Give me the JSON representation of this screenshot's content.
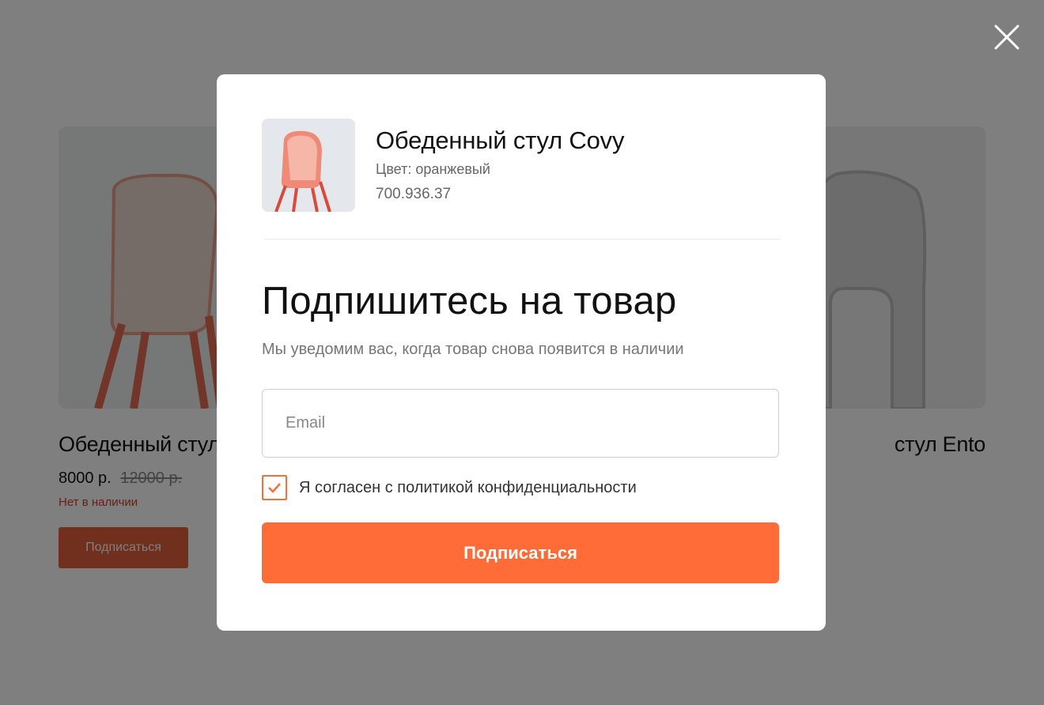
{
  "background": {
    "products": [
      {
        "title": "Обеденный стул",
        "price": "8000 р.",
        "old_price": "12000 р.",
        "stock": "Нет в наличии",
        "button": "Подписаться"
      },
      {
        "title": "стул Ento"
      }
    ]
  },
  "modal": {
    "close_icon": "close-icon",
    "product": {
      "name": "Обеденный стул Covy",
      "color": "Цвет: оранжевый",
      "sku": "700.936.37"
    },
    "heading": "Подпишитесь на товар",
    "subtext": "Мы уведомим вас, когда товар снова появится в наличии",
    "email_placeholder": "Email",
    "email_value": "",
    "consent_label": "Я согласен с политикой конфиденциальности",
    "consent_checked": true,
    "submit_label": "Подписаться"
  },
  "colors": {
    "accent": "#ff6c37",
    "out_of_stock": "#d33a2a",
    "overlay": "rgba(0,0,0,0.5)"
  }
}
